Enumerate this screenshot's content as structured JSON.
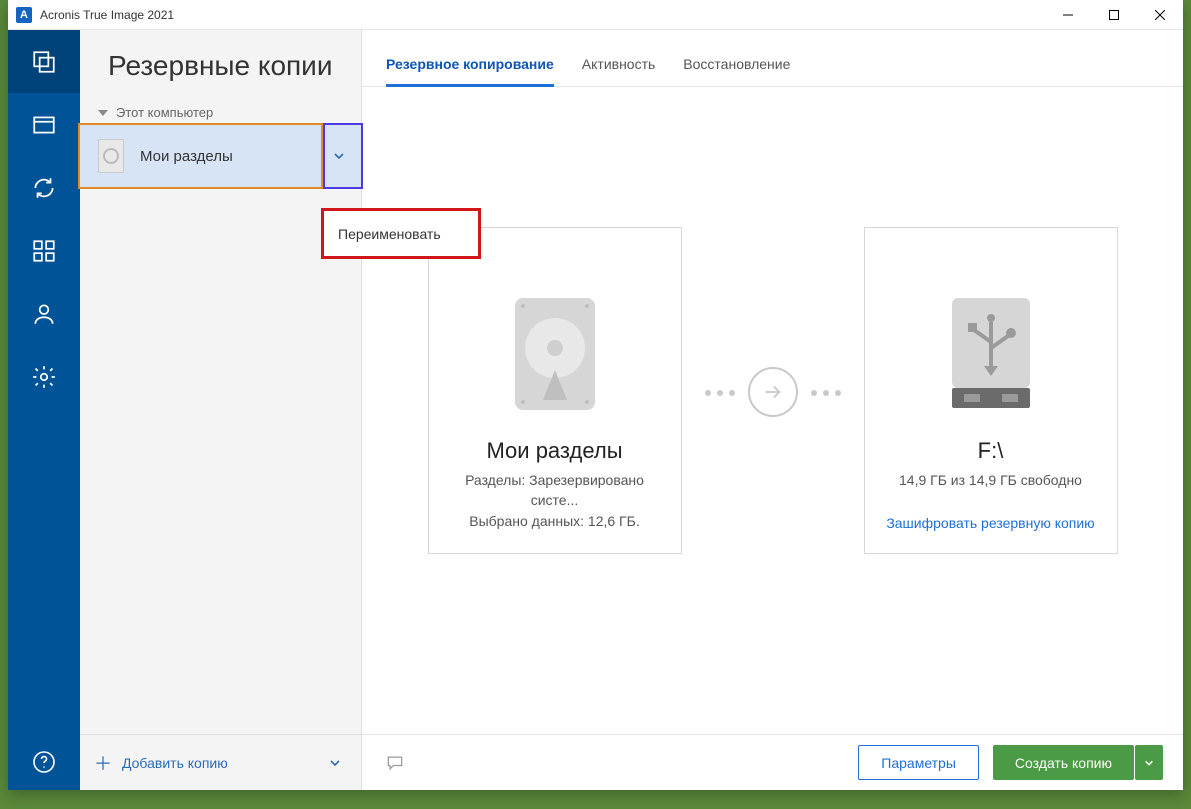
{
  "titlebar": {
    "app_letter": "A",
    "title": "Acronis True Image 2021"
  },
  "panel": {
    "heading": "Резервные копии",
    "tree_header": "Этот компьютер",
    "item_label": "Мои разделы",
    "context_rename": "Переименовать",
    "add_label": "Добавить копию"
  },
  "tabs": {
    "backup": "Резервное копирование",
    "activity": "Активность",
    "restore": "Восстановление"
  },
  "source_card": {
    "title": "Мои разделы",
    "line1": "Разделы: Зарезервировано систе...",
    "line2": "Выбрано данных: 12,6 ГБ."
  },
  "dest_card": {
    "title": "F:\\",
    "line1": "14,9 ГБ из 14,9 ГБ свободно",
    "encrypt": "Зашифровать резервную копию"
  },
  "footer": {
    "params": "Параметры",
    "create": "Создать копию"
  }
}
